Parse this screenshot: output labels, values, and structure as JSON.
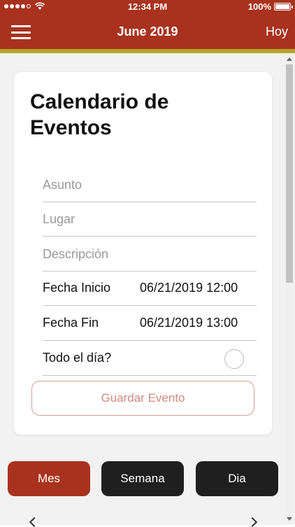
{
  "status_bar": {
    "time": "12:34 PM",
    "battery": "100%"
  },
  "nav": {
    "title": "June 2019",
    "today_label": "Hoy",
    "menu_icon": "hamburger-menu-icon"
  },
  "form": {
    "title": "Calendario de Eventos",
    "subject_placeholder": "Asunto",
    "location_placeholder": "Lugar",
    "description_placeholder": "Descripción",
    "start_label": "Fecha Inicio",
    "start_value": "06/21/2019 12:00",
    "end_label": "Fecha Fin",
    "end_value": "06/21/2019 13:00",
    "allday_label": "Todo el día?",
    "save_label": "Guardar Evento"
  },
  "view_buttons": {
    "month": "Mes",
    "week": "Semana",
    "day": "Dia"
  },
  "colors": {
    "primary": "#a8321e",
    "accent_gold": "#b3a52a",
    "dark_button": "#1f1f1f"
  }
}
